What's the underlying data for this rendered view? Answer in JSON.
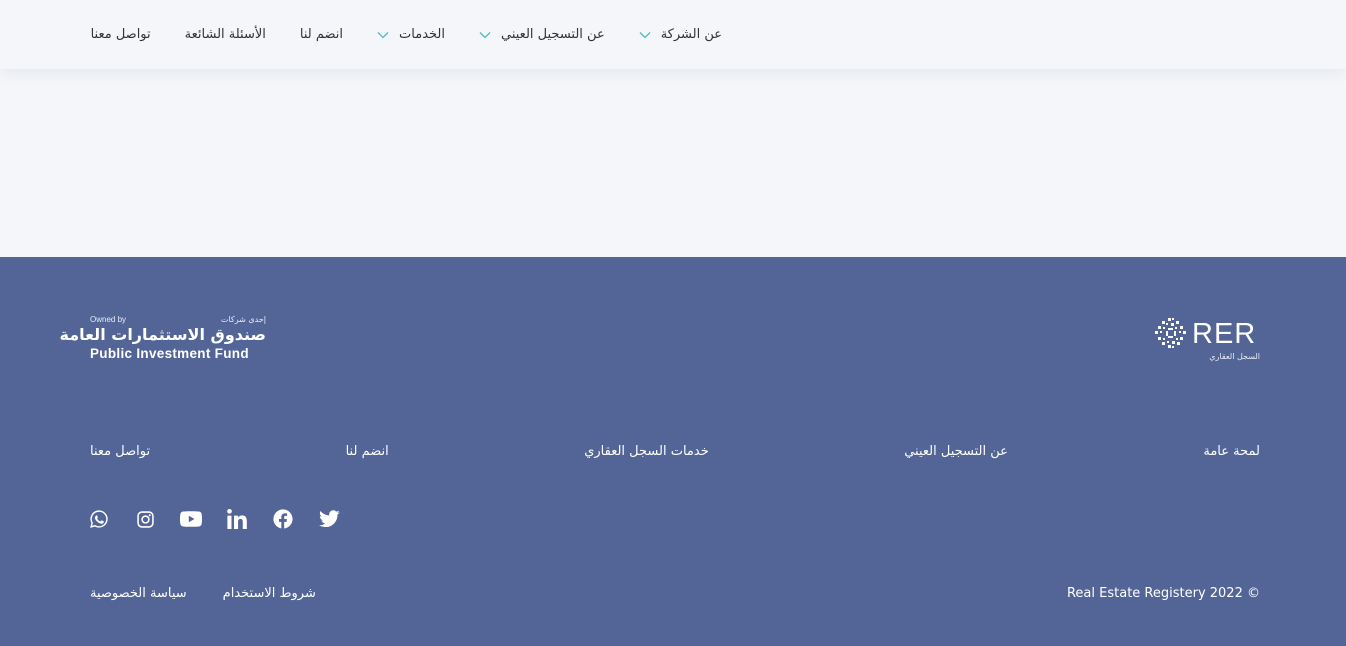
{
  "header": {
    "nav": [
      {
        "label": "عن الشركة",
        "has_dropdown": true,
        "icon": "chevron-down-icon"
      },
      {
        "label": "عن التسجيل العيني",
        "has_dropdown": true,
        "icon": "chevron-down-icon"
      },
      {
        "label": "الخدمات",
        "has_dropdown": true,
        "icon": "chevron-down-icon"
      },
      {
        "label": "انضم لنا",
        "has_dropdown": false
      },
      {
        "label": "الأسئلة الشائعة",
        "has_dropdown": false
      },
      {
        "label": "تواصل معنا",
        "has_dropdown": false
      }
    ],
    "chevron_color": "#4bb8c9"
  },
  "footer": {
    "background": "#536497",
    "rer_logo": {
      "text": "RER",
      "subtitle": "السجل العقاري"
    },
    "pif_logo": {
      "owned_by": "Owned by",
      "part_of": "إحدى شركات",
      "name_ar": "صندوق الاستثمارات العامة",
      "name_en": "Public Investment Fund"
    },
    "links": [
      {
        "label": "لمحة عامة"
      },
      {
        "label": "عن التسجيل العيني"
      },
      {
        "label": "خدمات السجل العقاري"
      },
      {
        "label": "انضم لنا"
      },
      {
        "label": "تواصل معنا"
      }
    ],
    "social_icons": [
      "twitter-icon",
      "facebook-icon",
      "linkedin-icon",
      "youtube-icon",
      "instagram-icon",
      "whatsapp-icon"
    ],
    "copyright": "Real Estate Registery 2022 ©",
    "legal": {
      "terms": "شروط الاستخدام",
      "privacy": "سياسة الخصوصية"
    }
  }
}
